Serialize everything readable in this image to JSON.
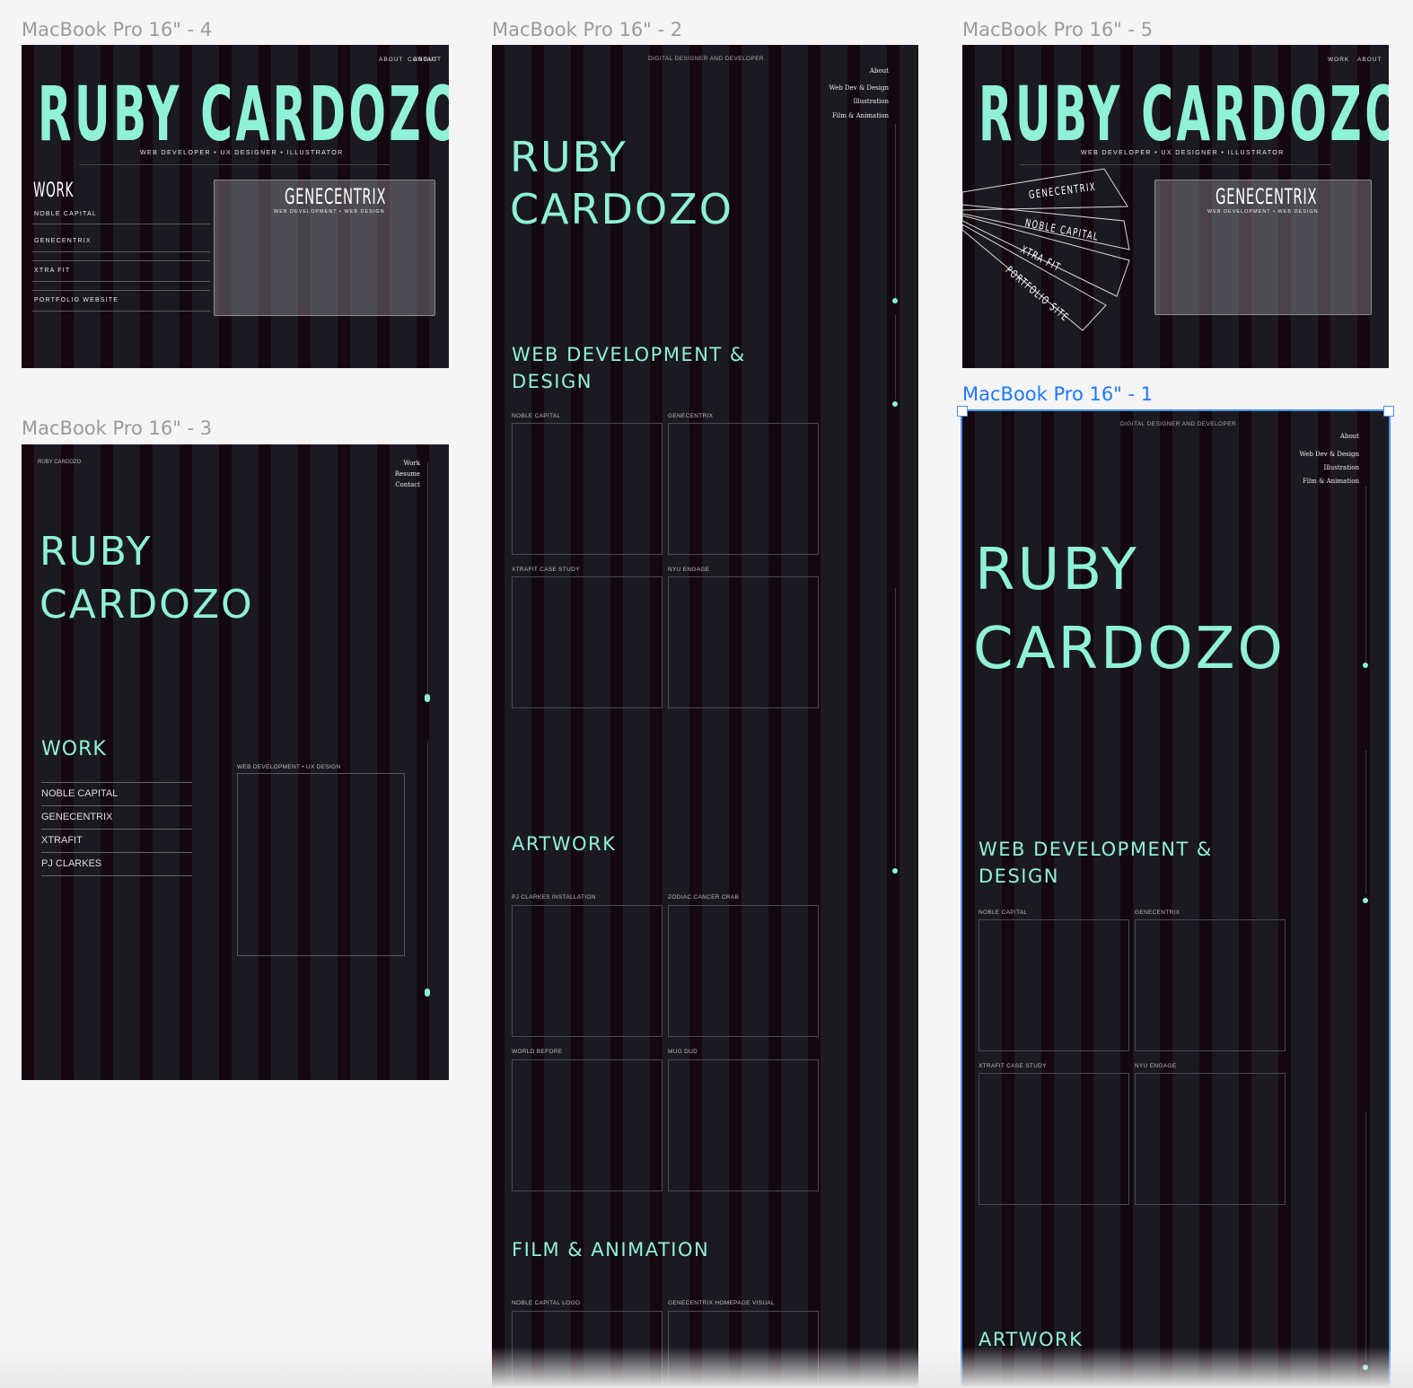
{
  "frames": {
    "f4": {
      "label": "MacBook Pro 16\" - 4",
      "nav": [
        "ABOUT",
        "CONTACT"
      ],
      "name": "RUBY CARDOZO",
      "tagline": "WEB DEVELOPER • UX DESIGNER  • ILLUSTRATOR",
      "work_title": "WORK",
      "work_items": [
        "NOBLE CAPITAL",
        "GENECENTRIX",
        "XTRA FIT",
        "PORTFOLIO WEBSITE"
      ],
      "preview_title": "GENECENTRIX",
      "preview_sub": "WEB DEVELOPMENT • WEB DESIGN"
    },
    "f2": {
      "label": "MacBook Pro 16\" - 2",
      "header": "DIGITAL DESIGNER AND DEVELOPER",
      "nav": [
        "About",
        "Web Dev & Design",
        "Illustration",
        "Film & Animation"
      ],
      "name_line1": "RUBY",
      "name_line2": "CARDOZO",
      "section1": "WEB DEVELOPMENT & DESIGN",
      "section1_items": [
        "NOBLE CAPITAL",
        "GENECENTRIX",
        "XTRAFIT CASE STUDY",
        "NYU ENGAGE"
      ],
      "section2": "ARTWORK",
      "section2_items": [
        "PJ CLARKES INSTALLATION",
        "ZODIAC CANCER CRAB",
        "WORLD BEFORE",
        "MUG DUD"
      ],
      "section3": "FILM & ANIMATION",
      "section3_items": [
        "NOBLE CAPITAL LOGO",
        "GENECENTRIX HOMEPAGE VISUAL"
      ]
    },
    "f5": {
      "label": "MacBook Pro 16\" - 5",
      "nav": [
        "WORK",
        "ABOUT"
      ],
      "name": "RUBY CARDOZO",
      "tagline": "WEB DEVELOPER • UX DESIGNER  • ILLUSTRATOR",
      "fan_items": [
        "GENECENTRIX",
        "NOBLE CAPITAL",
        "XTRA FIT",
        "PORTFOLIO SITE"
      ],
      "preview_title": "GENECENTRIX",
      "preview_sub": "WEB DEVELOPMENT • WEB DESIGN"
    },
    "f3": {
      "label": "MacBook Pro 16\" - 3",
      "brand": "RUBY CARDOZO",
      "nav": [
        "Work",
        "Resume",
        "Contact"
      ],
      "name_line1": "RUBY",
      "name_line2": "CARDOZO",
      "work_title": "WORK",
      "work_items": [
        "NOBLE CAPITAL",
        "GENECENTRIX",
        "XTRAFIT",
        "PJ CLARKES"
      ],
      "preview_label": "WEB DEVELOPMENT • UX DESIGN"
    },
    "f1": {
      "label": "MacBook Pro 16\" - 1",
      "header": "DIGITAL DESIGNER AND DEVELOPER",
      "nav": [
        "About",
        "Web Dev & Design",
        "Illustration",
        "Film & Animation"
      ],
      "name_line1": "RUBY",
      "name_line2": "CARDOZO",
      "section1": "WEB DEVELOPMENT & DESIGN",
      "section1_items": [
        "NOBLE CAPITAL",
        "GENECENTRIX",
        "XTRAFIT CASE STUDY",
        "NYU ENGAGE"
      ],
      "section2": "ARTWORK"
    }
  },
  "colors": {
    "accent": "#8ff2d6",
    "selection": "#1e78ff",
    "frame_bg": "#130810",
    "column": "#1c1a21",
    "canvas": "#f5f5f5"
  }
}
